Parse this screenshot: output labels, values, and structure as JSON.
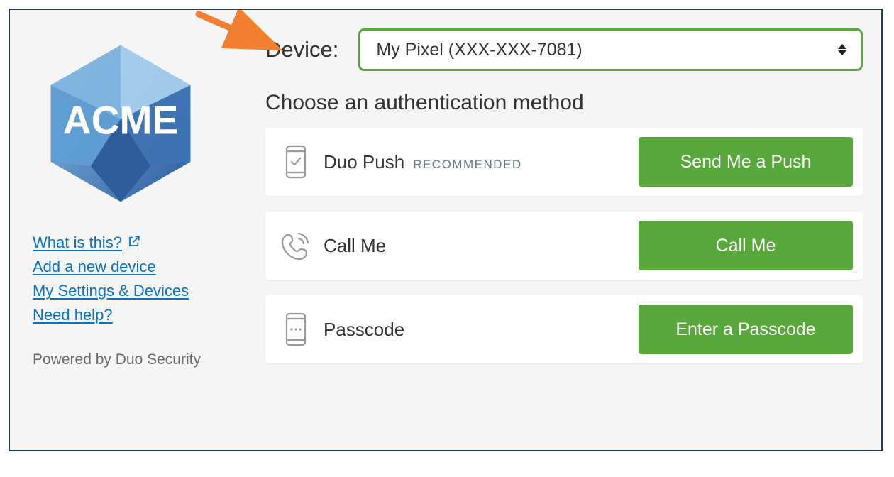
{
  "logo_text": "ACME",
  "links": {
    "what_is_this": "What is this?",
    "add_device": "Add a new device",
    "settings": "My Settings & Devices",
    "help": "Need help?"
  },
  "powered": "Powered by Duo Security",
  "device_label": "Device:",
  "device_selected": "My Pixel (XXX-XXX-7081)",
  "choose_heading": "Choose an authentication method",
  "methods": {
    "push": {
      "title": "Duo Push",
      "badge": "RECOMMENDED",
      "button": "Send Me a Push"
    },
    "call": {
      "title": "Call Me",
      "button": "Call Me"
    },
    "passcode": {
      "title": "Passcode",
      "button": "Enter a Passcode"
    }
  },
  "colors": {
    "accent_green": "#59a83c",
    "link_blue": "#0b72c4",
    "frame_border": "#1f3a52",
    "arrow": "#f08030"
  }
}
